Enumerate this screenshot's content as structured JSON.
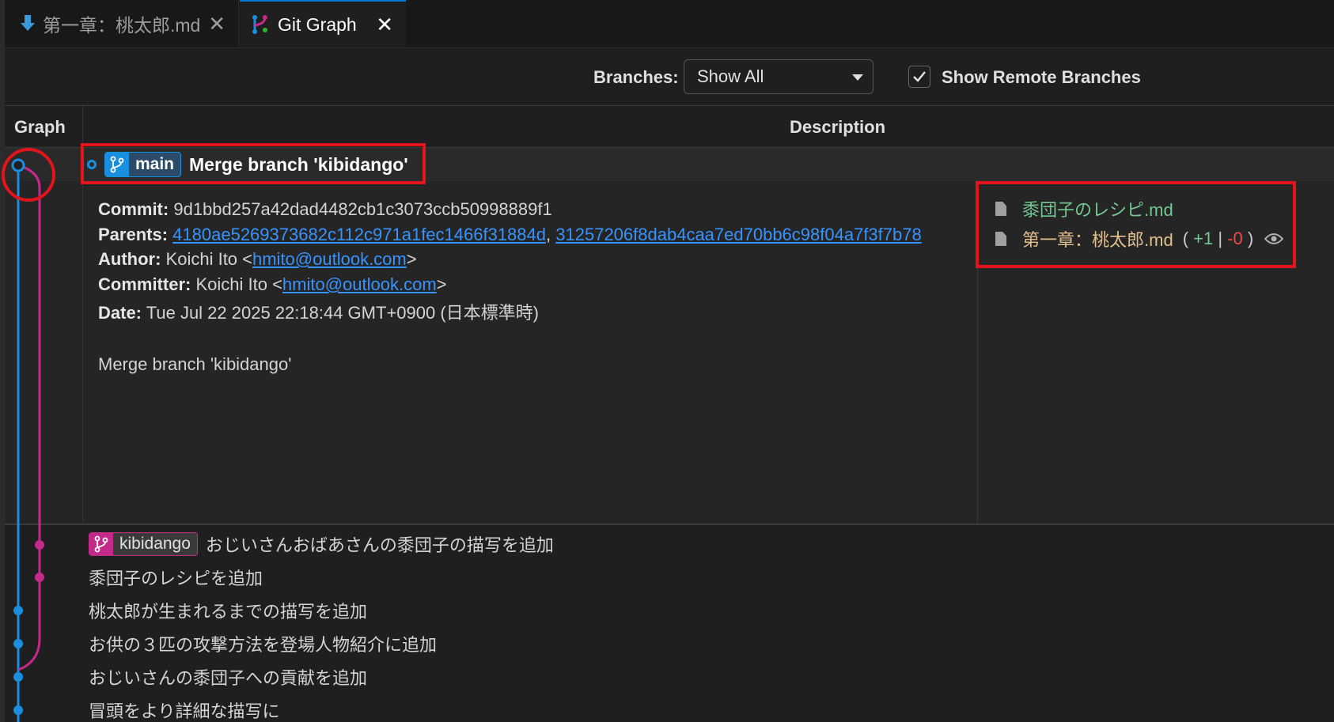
{
  "tabs": [
    {
      "label": "第一章：桃太郎.md",
      "icon": "markdown-download-icon",
      "close": "✕"
    },
    {
      "label": "Git Graph",
      "icon": "git-graph-icon",
      "close": "✕"
    }
  ],
  "controls": {
    "branches_label": "Branches:",
    "branches_value": "Show All",
    "show_remote_label": "Show Remote Branches",
    "show_remote_checked": true
  },
  "table": {
    "graph_header": "Graph",
    "description_header": "Description"
  },
  "selected_commit": {
    "ref": "main",
    "message": "Merge branch 'kibidango'",
    "commit_label": "Commit:",
    "commit_hash": "9d1bbd257a42dad4482cb1c3073ccb50998889f1",
    "parents_label": "Parents:",
    "parent_1": "4180ae5269373682c112c971a1fec1466f31884d",
    "parent_sep": ",",
    "parent_2": "31257206f8dab4caa7ed70bb6c98f04a7f3f7b78",
    "author_label": "Author:",
    "author_name": "Koichi Ito <",
    "author_email": "hmito@outlook.com",
    "author_suffix": ">",
    "committer_label": "Committer:",
    "committer_name": "Koichi Ito <",
    "committer_email": "hmito@outlook.com",
    "committer_suffix": ">",
    "date_label": "Date:",
    "date_value": "Tue Jul 22 2025 22:18:44 GMT+0900 (日本標準時)",
    "body": "Merge branch 'kibidango'",
    "files": [
      {
        "name": "黍団子のレシピ.md",
        "status": "added"
      },
      {
        "name": "第一章：桃太郎.md",
        "status": "modified",
        "paren_open": "(",
        "additions": "+1",
        "separator": "|",
        "deletions": "-0",
        "paren_close": ")"
      }
    ]
  },
  "commits": [
    {
      "ref": "kibidango",
      "message": "おじいさんおばあさんの黍団子の描写を追加"
    },
    {
      "message": "黍団子のレシピを追加"
    },
    {
      "message": "桃太郎が生まれるまでの描写を追加"
    },
    {
      "message": "お供の３匹の攻撃方法を登場人物紹介に追加"
    },
    {
      "message": "おじいさんの黍団子への貢献を追加"
    },
    {
      "message": "冒頭をより詳細な描写に"
    }
  ],
  "colors": {
    "main_branch": "#1a8fe0",
    "kibidango_branch": "#c42a8a",
    "highlight": "#e3141c",
    "link": "#3794ff"
  }
}
